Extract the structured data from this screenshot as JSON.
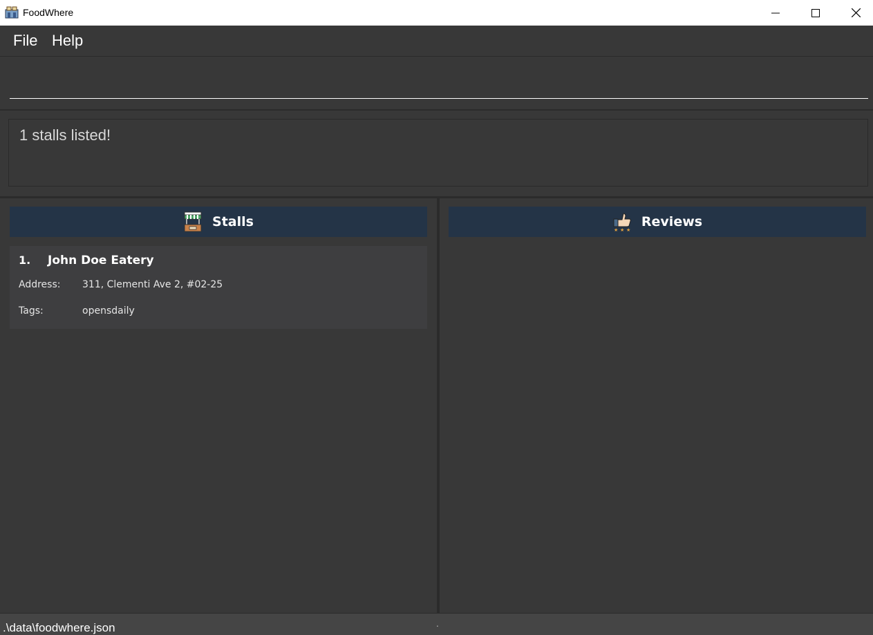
{
  "window": {
    "title": "FoodWhere",
    "controls": {
      "minimize": "minimize-icon",
      "maximize": "maximize-icon",
      "close": "close-icon"
    }
  },
  "menu": {
    "file": "File",
    "help": "Help"
  },
  "command": {
    "value": "",
    "placeholder": ""
  },
  "result": {
    "message": "1 stalls listed!"
  },
  "stalls_panel": {
    "title": "Stalls",
    "icon": "stall-icon",
    "items": [
      {
        "index": "1.",
        "name": "John Doe Eatery",
        "address_label": "Address:",
        "address": "311, Clementi Ave 2, #02-25",
        "tags_label": "Tags:",
        "tags": "opensdaily"
      }
    ]
  },
  "reviews_panel": {
    "title": "Reviews",
    "icon": "thumbs-up-review-icon",
    "items": []
  },
  "status_bar": {
    "path": ".\\data\\foodwhere.json",
    "right_text": "."
  },
  "colors": {
    "background": "#383838",
    "header_bar": "#243447",
    "card": "#3e3e40",
    "text": "#ffffff"
  }
}
